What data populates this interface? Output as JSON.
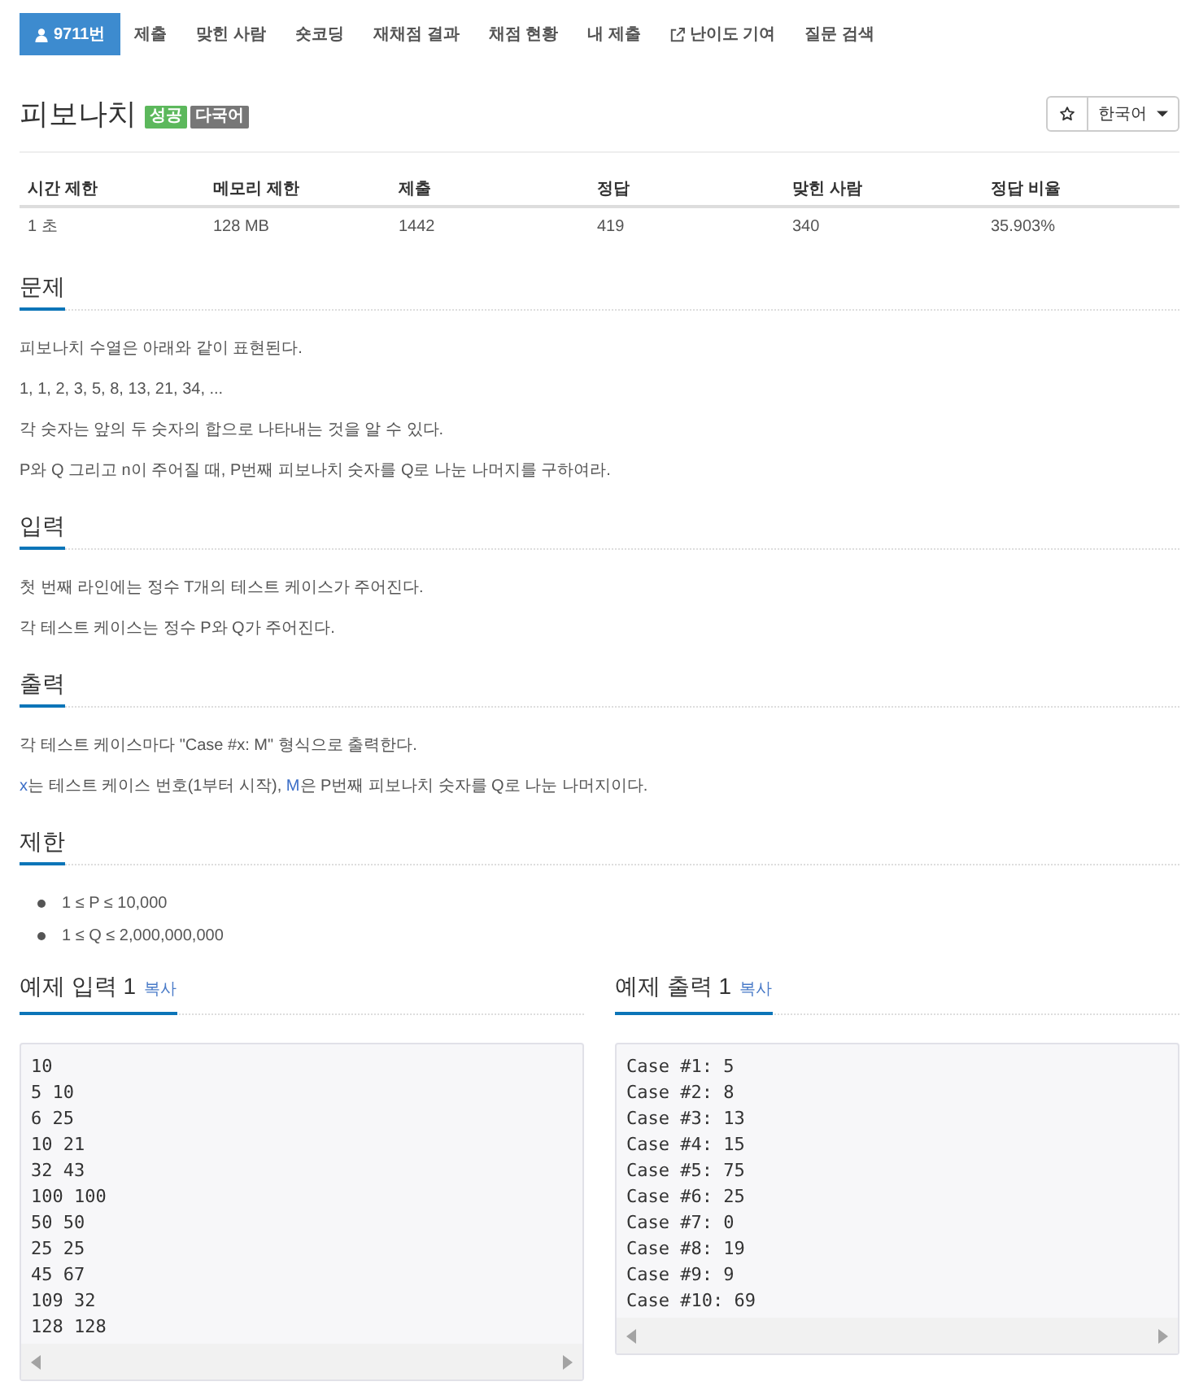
{
  "nav": {
    "tabs": [
      {
        "label": "9711번",
        "kind": "problem",
        "selected": true
      },
      {
        "label": "제출",
        "kind": "page",
        "selected": false
      },
      {
        "label": "맞힌 사람",
        "kind": "page",
        "selected": false
      },
      {
        "label": "숏코딩",
        "kind": "page",
        "selected": false
      },
      {
        "label": "재채점 결과",
        "kind": "page",
        "selected": false
      },
      {
        "label": "채점 현황",
        "kind": "page",
        "selected": false
      },
      {
        "label": "내 제출",
        "kind": "page",
        "selected": false
      },
      {
        "label": "난이도 기여",
        "kind": "external",
        "selected": false
      },
      {
        "label": "질문 검색",
        "kind": "page",
        "selected": false
      }
    ]
  },
  "problem": {
    "title": "피보나치",
    "tags": [
      {
        "label": "성공",
        "color": "#5cb85c"
      },
      {
        "label": "다국어",
        "color": "#777777"
      }
    ],
    "language": "한국어"
  },
  "info_table": {
    "columns": [
      "시간 제한",
      "메모리 제한",
      "제출",
      "정답",
      "맞힌 사람",
      "정답 비율"
    ],
    "rows": [
      [
        "1 초",
        "128 MB",
        "1442",
        "419",
        "340",
        "35.903%"
      ]
    ]
  },
  "sections": [
    {
      "heading": "문제",
      "kind": "text",
      "paragraphs": [
        [
          {
            "text": "피보나치 수열은 아래와 같이 표현된다.",
            "kind": "plain"
          }
        ],
        [
          {
            "text": "1, 1, 2, 3, 5, 8, 13, 21, 34, ...",
            "kind": "plain"
          }
        ],
        [
          {
            "text": "각 숫자는 앞의 두 숫자의 합으로 나타내는 것을 알 수 있다.",
            "kind": "plain"
          }
        ],
        [
          {
            "text": "P와 Q 그리고 n이 주어질 때, P번째 피보나치 숫자를 Q로 나눈 나머지를 구하여라.",
            "kind": "plain"
          }
        ]
      ]
    },
    {
      "heading": "입력",
      "kind": "text",
      "paragraphs": [
        [
          {
            "text": "첫 번째 라인에는 정수 T개의 테스트 케이스가 주어진다.",
            "kind": "plain"
          }
        ],
        [
          {
            "text": "각 테스트 케이스는 정수 P와 Q가 주어진다.",
            "kind": "plain"
          }
        ]
      ]
    },
    {
      "heading": "출력",
      "kind": "text",
      "paragraphs": [
        [
          {
            "text": "각 테스트 케이스마다 \"Case #x: M\" 형식으로 출력한다.",
            "kind": "plain"
          }
        ],
        [
          {
            "text": "x",
            "kind": "math"
          },
          {
            "text": "는 테스트 케이스 번호(1부터 시작), ",
            "kind": "plain"
          },
          {
            "text": "M",
            "kind": "math"
          },
          {
            "text": "은 P번째 피보나치 숫자를 Q로 나눈 나머지이다.",
            "kind": "plain"
          }
        ]
      ]
    },
    {
      "heading": "제한",
      "kind": "list",
      "items": [
        "1 ≤ P ≤ 10,000",
        "1 ≤ Q ≤ 2,000,000,000"
      ]
    }
  ],
  "examples": [
    {
      "heading": "예제 입력 1",
      "copy_label": "복사",
      "lines": [
        "10",
        "5 10",
        "6 25",
        "10 21",
        "32 43",
        "100 100",
        "50 50",
        "25 25",
        "45 67",
        "109 32",
        "128 128"
      ]
    },
    {
      "heading": "예제 출력 1",
      "copy_label": "복사",
      "lines": [
        "Case #1: 5",
        "Case #2: 8",
        "Case #3: 13",
        "Case #4: 15",
        "Case #5: 75",
        "Case #6: 25",
        "Case #7: 0",
        "Case #8: 19",
        "Case #9: 9",
        "Case #10: 69"
      ]
    }
  ]
}
